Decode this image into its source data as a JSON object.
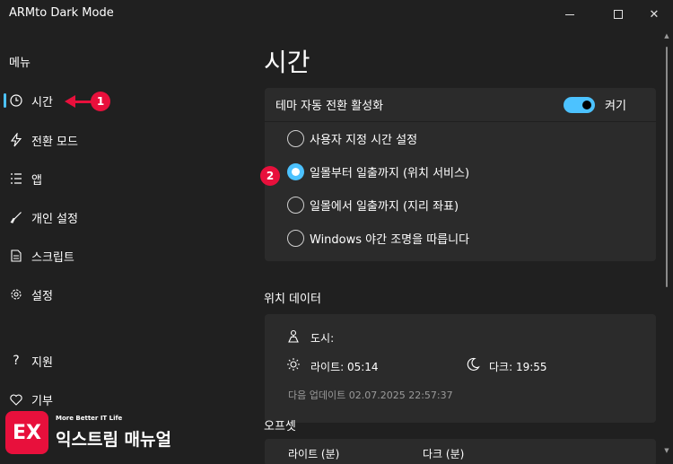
{
  "window": {
    "title": "ARMto Dark Mode"
  },
  "sidebar": {
    "heading": "메뉴",
    "items": [
      {
        "label": "시간",
        "icon": "clock-icon"
      },
      {
        "label": "전환 모드",
        "icon": "bolt-icon"
      },
      {
        "label": "앱",
        "icon": "list-icon"
      },
      {
        "label": "개인 설정",
        "icon": "brush-icon"
      },
      {
        "label": "스크립트",
        "icon": "document-icon"
      },
      {
        "label": "설정",
        "icon": "gear-icon"
      },
      {
        "label": "지원",
        "icon": "question-icon"
      },
      {
        "label": "기부",
        "icon": "heart-icon"
      }
    ]
  },
  "annotations": {
    "one": "1",
    "two": "2"
  },
  "main": {
    "title": "시간",
    "theme_toggle": {
      "label": "테마 자동 전환 활성화",
      "state": "켜기",
      "on": true
    },
    "options": [
      {
        "label": "사용자 지정 시간 설정",
        "checked": false
      },
      {
        "label": "일몰부터 일출까지 (위치 서비스)",
        "checked": true
      },
      {
        "label": "일몰에서 일출까지 (지리 좌표)",
        "checked": false
      },
      {
        "label": "Windows 야간 조명을 따릅니다",
        "checked": false
      }
    ],
    "location": {
      "heading": "위치 데이터",
      "city_label": "도시:",
      "light_label": "라이트: 05:14",
      "dark_label": "다크: 19:55",
      "next_update": "다음 업데이트 02.07.2025 22:57:37"
    },
    "offset": {
      "heading": "오프셋",
      "light_label": "라이트 (분)",
      "dark_label": "다크 (분)"
    }
  },
  "logo": {
    "tagline": "More Better IT Life",
    "name": "익스트림 매뉴얼",
    "mark": "EX"
  },
  "colors": {
    "accent": "#4cc2ff",
    "annotation": "#e8103c",
    "background": "#202020",
    "card": "#2b2b2b"
  }
}
